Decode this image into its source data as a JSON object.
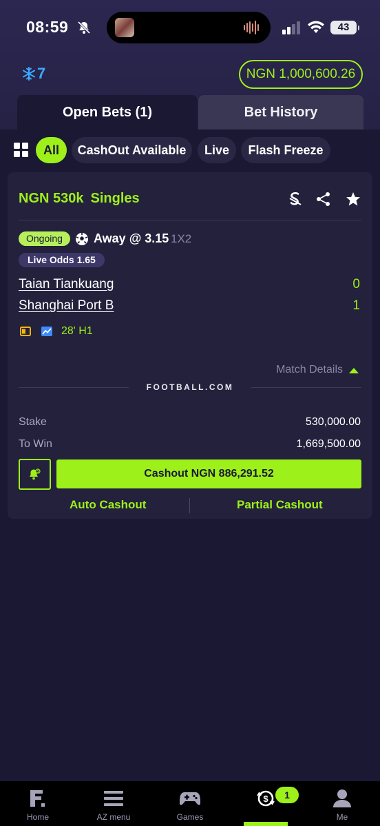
{
  "status_bar": {
    "time": "08:59",
    "battery": "43"
  },
  "header": {
    "freeze_count": "7",
    "balance": "NGN 1,000,600.26"
  },
  "tabs": {
    "open_bets": "Open Bets (1)",
    "bet_history": "Bet History"
  },
  "filters": {
    "items": [
      "All",
      "CashOut Available",
      "Live",
      "Flash Freeze"
    ],
    "active": "All"
  },
  "bet": {
    "amount": "NGN 530k",
    "type": "Singles",
    "status": "Ongoing",
    "selection": "Away @ 3.15",
    "market": "1X2",
    "live_odds": "Live Odds 1.65",
    "home_team": "Taian Tiankuang",
    "away_team": "Shanghai Port B",
    "home_score": "0",
    "away_score": "1",
    "match_clock": "28' H1",
    "match_details_label": "Match Details",
    "provider_logo": "FOOTBALL.COM",
    "stake_label": "Stake",
    "stake_value": "530,000.00",
    "to_win_label": "To Win",
    "to_win_value": "1,669,500.00",
    "cashout_label": "Cashout NGN 886,291.52",
    "auto_cashout_label": "Auto Cashout",
    "partial_cashout_label": "Partial Cashout"
  },
  "bottom_nav": {
    "items": [
      {
        "label": "Home",
        "icon": "home-logo-icon"
      },
      {
        "label": "AZ menu",
        "icon": "menu-icon"
      },
      {
        "label": "Games",
        "icon": "gamepad-icon"
      },
      {
        "label": "",
        "icon": "open-bets-icon"
      },
      {
        "label": "Me",
        "icon": "user-icon"
      }
    ],
    "open_bets_badge": "1"
  },
  "colors": {
    "accent": "#9ef01a",
    "background": "#1a1833",
    "card": "#23213c",
    "freeze": "#3da8ff"
  }
}
